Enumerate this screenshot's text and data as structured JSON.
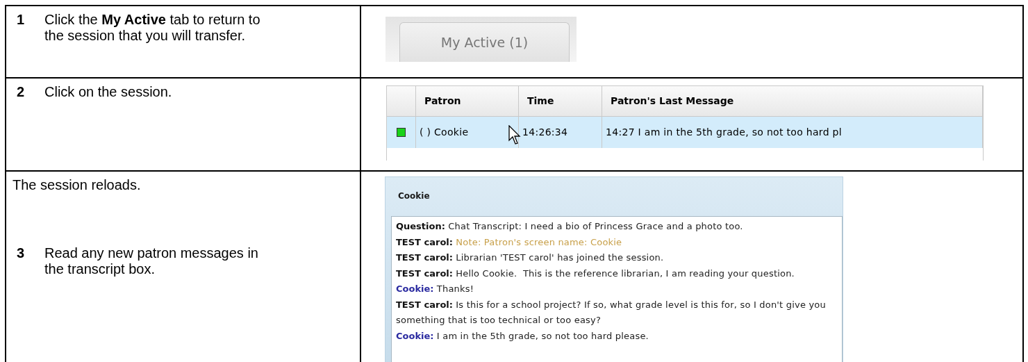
{
  "steps": [
    {
      "number": "1",
      "text": "Click the **My Active** tab to return to the session that you will transfer."
    },
    {
      "number": "2",
      "text": "Click on the session."
    },
    {
      "number": "3",
      "text": "Read any new patron messages in the transcript box.",
      "intro": "The session reloads."
    }
  ],
  "tab": {
    "label": "My Active (1)",
    "selected": false
  },
  "sessions": {
    "columns": [
      "Patron",
      "Time",
      "Patron's Last Message"
    ],
    "rows": [
      {
        "color": "#19d219",
        "selected": true,
        "patron": "( ) Cookie",
        "time": "14:26:34",
        "message": "14:27 I am in the 5th grade, so not too hard pl"
      }
    ]
  },
  "chat": {
    "title": "Cookie",
    "lines": [
      {
        "kind": "question",
        "speaker": "Question:",
        "text": "Chat Transcript: I need a bio of Princess Grace and a photo too."
      },
      {
        "kind": "note",
        "speaker": "TEST carol:",
        "text": "Note: Patron's screen name: Cookie"
      },
      {
        "kind": "librarian",
        "speaker": "TEST carol:",
        "text": "Librarian 'TEST carol' has joined the session."
      },
      {
        "kind": "librarian",
        "speaker": "TEST carol:",
        "text": "Hello Cookie.  This is the reference librarian, I am reading your question."
      },
      {
        "kind": "patron",
        "speaker": "Cookie:",
        "text": "Thanks!"
      },
      {
        "kind": "librarian",
        "speaker": "TEST carol:",
        "text": "Is this for a school project? If so, what grade level is this for, so I don't give you something that is too technical or too easy?"
      },
      {
        "kind": "patron",
        "speaker": "Cookie:",
        "text": "I am in the 5th grade, so not too hard please."
      }
    ]
  }
}
